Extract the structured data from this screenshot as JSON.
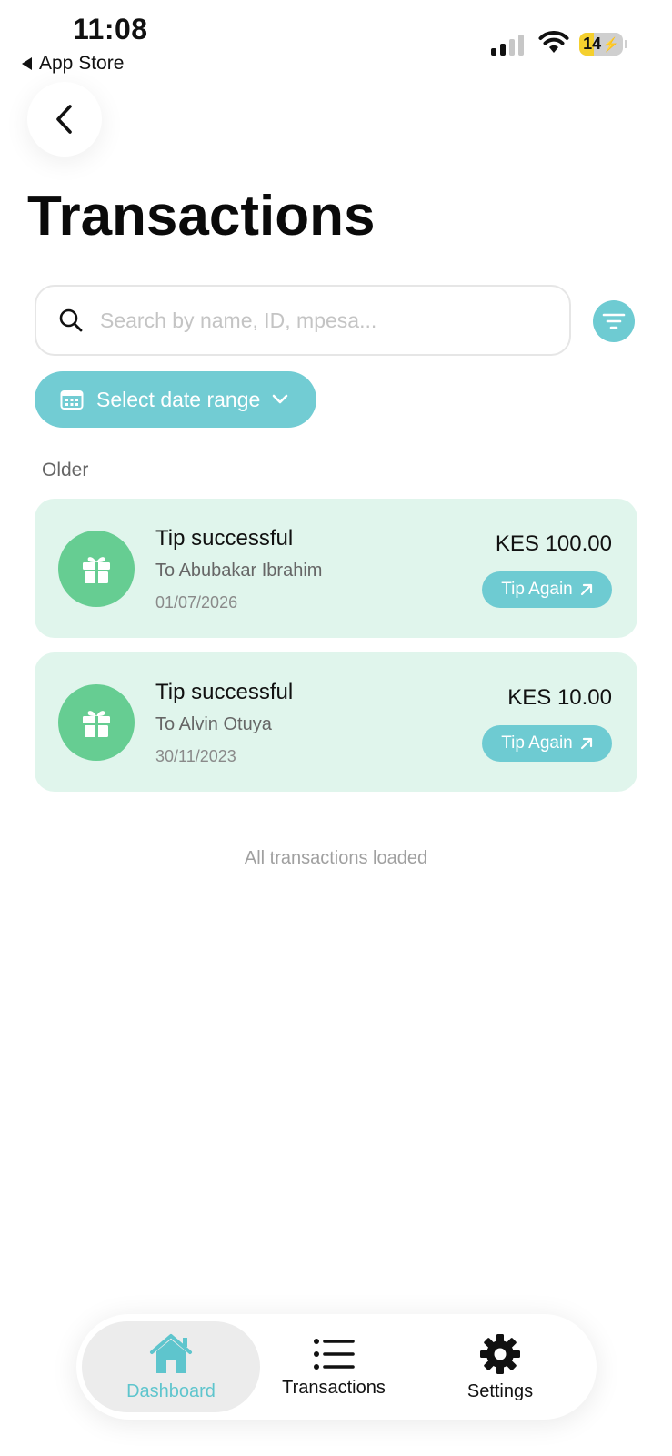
{
  "status_bar": {
    "time": "11:08",
    "back_app": "App Store",
    "battery_level": "14"
  },
  "page": {
    "title": "Transactions"
  },
  "search": {
    "placeholder": "Search by name, ID, mpesa..."
  },
  "date_filter": {
    "label": "Select date range"
  },
  "section_label": "Older",
  "transactions": [
    {
      "status": "Tip successful",
      "recipient": "To Abubakar Ibrahim",
      "date": "01/07/2026",
      "amount": "KES 100.00",
      "action_label": "Tip Again",
      "icon": "gift-icon"
    },
    {
      "status": "Tip successful",
      "recipient": "To Alvin Otuya",
      "date": "30/11/2023",
      "amount": "KES 10.00",
      "action_label": "Tip Again",
      "icon": "gift-icon"
    }
  ],
  "footer_note": "All transactions loaded",
  "bottom_nav": {
    "items": [
      {
        "label": "Dashboard",
        "icon": "home-icon",
        "active": true
      },
      {
        "label": "Transactions",
        "icon": "list-icon",
        "active": false
      },
      {
        "label": "Settings",
        "icon": "gear-icon",
        "active": false
      }
    ]
  },
  "colors": {
    "accent": "#6ecbd2",
    "card_background": "#e0f5ec",
    "gift_circle": "#66cd92",
    "active_nav_label": "#5ec5cd"
  }
}
